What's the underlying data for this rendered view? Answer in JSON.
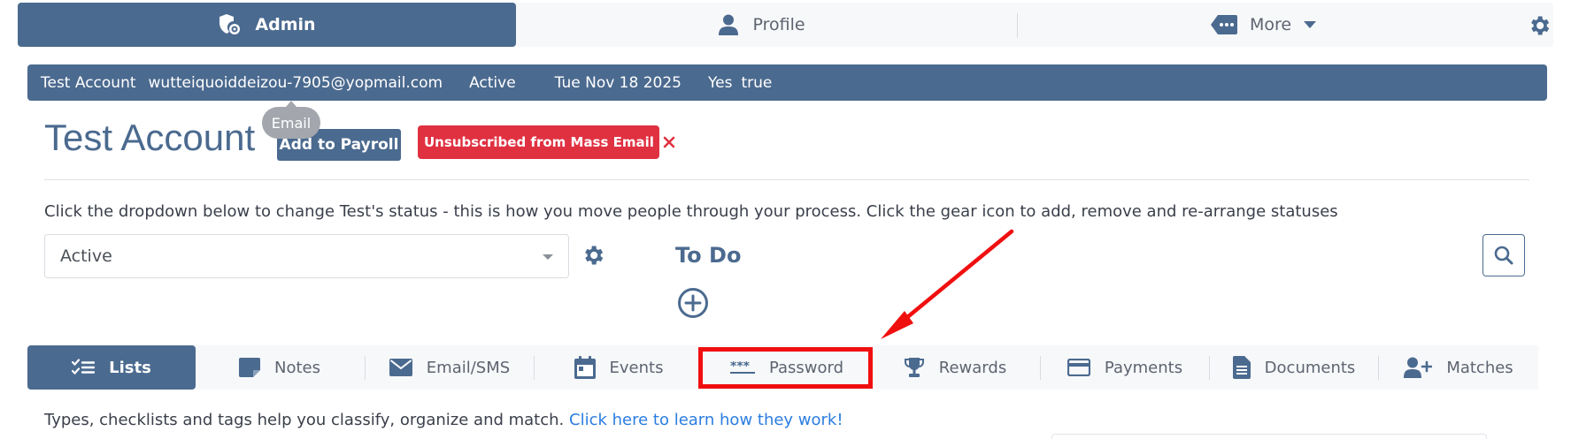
{
  "topnav": {
    "admin_label": "Admin",
    "profile_label": "Profile",
    "more_label": "More"
  },
  "infobar": {
    "name": "Test Account",
    "email": "wutteiquoiddeizou-7905@yopmail.com",
    "status": "Active",
    "date": "Tue Nov 18 2025",
    "yes": "Yes",
    "flag": "true"
  },
  "tooltip": {
    "text": "Email"
  },
  "header": {
    "title": "Test Account",
    "payroll_button": "Add to Payroll",
    "unsubscribed_badge": "Unsubscribed from Mass Email"
  },
  "status_section": {
    "hint": "Click the dropdown below to change Test's status - this is how you move people through your process. Click the gear icon to add, remove and re-arrange statuses",
    "selected": "Active"
  },
  "todo": {
    "title": "To Do"
  },
  "tabs": [
    {
      "label": "Lists",
      "icon": "checklist-icon",
      "active": true
    },
    {
      "label": "Notes",
      "icon": "note-icon"
    },
    {
      "label": "Email/SMS",
      "icon": "envelope-icon"
    },
    {
      "label": "Events",
      "icon": "calendar-icon"
    },
    {
      "label": "Password",
      "icon": "asterisks-icon",
      "highlighted": true
    },
    {
      "label": "Rewards",
      "icon": "trophy-icon"
    },
    {
      "label": "Payments",
      "icon": "credit-card-icon"
    },
    {
      "label": "Documents",
      "icon": "document-icon"
    },
    {
      "label": "Matches",
      "icon": "user-plus-icon"
    }
  ],
  "types_section": {
    "text": "Types, checklists and tags help you classify, organize and match.",
    "link": "Click here to learn how they work!"
  },
  "colors": {
    "primary": "#4b6a8f",
    "danger": "#e03141",
    "annotation": "#f00f0f",
    "link": "#2b7de0"
  }
}
